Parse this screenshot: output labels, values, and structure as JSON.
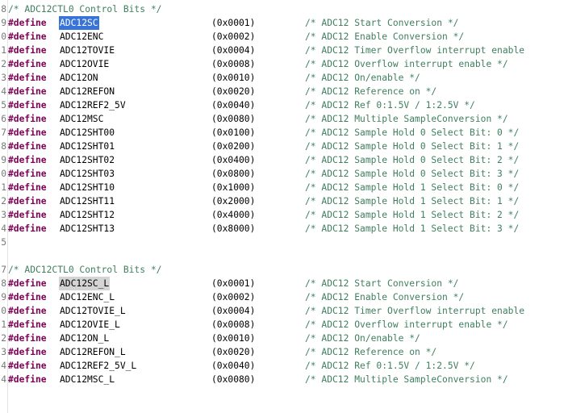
{
  "editor": {
    "keyword": "#define",
    "block1": {
      "line_number": "8",
      "header": "/* ADC12CTL0 Control Bits */",
      "rows": [
        {
          "ln": "9",
          "name": "ADC12SC",
          "value": "(0x0001)",
          "comment": "/* ADC12 Start Conversion */",
          "state": "selected"
        },
        {
          "ln": "0",
          "name": "ADC12ENC",
          "value": "(0x0002)",
          "comment": "/* ADC12 Enable Conversion */",
          "state": ""
        },
        {
          "ln": "1",
          "name": "ADC12TOVIE",
          "value": "(0x0004)",
          "comment": "/* ADC12 Timer Overflow interrupt enable",
          "state": ""
        },
        {
          "ln": "2",
          "name": "ADC12OVIE",
          "value": "(0x0008)",
          "comment": "/* ADC12 Overflow interrupt enable */",
          "state": ""
        },
        {
          "ln": "3",
          "name": "ADC12ON",
          "value": "(0x0010)",
          "comment": "/* ADC12 On/enable */",
          "state": ""
        },
        {
          "ln": "4",
          "name": "ADC12REFON",
          "value": "(0x0020)",
          "comment": "/* ADC12 Reference on */",
          "state": ""
        },
        {
          "ln": "5",
          "name": "ADC12REF2_5V",
          "value": "(0x0040)",
          "comment": "/* ADC12 Ref 0:1.5V / 1:2.5V */",
          "state": ""
        },
        {
          "ln": "6",
          "name": "ADC12MSC",
          "value": "(0x0080)",
          "comment": "/* ADC12 Multiple SampleConversion */",
          "state": ""
        },
        {
          "ln": "7",
          "name": "ADC12SHT00",
          "value": "(0x0100)",
          "comment": "/* ADC12 Sample Hold 0 Select Bit: 0 */",
          "state": ""
        },
        {
          "ln": "8",
          "name": "ADC12SHT01",
          "value": "(0x0200)",
          "comment": "/* ADC12 Sample Hold 0 Select Bit: 1 */",
          "state": ""
        },
        {
          "ln": "9",
          "name": "ADC12SHT02",
          "value": "(0x0400)",
          "comment": "/* ADC12 Sample Hold 0 Select Bit: 2 */",
          "state": ""
        },
        {
          "ln": "0",
          "name": "ADC12SHT03",
          "value": "(0x0800)",
          "comment": "/* ADC12 Sample Hold 0 Select Bit: 3 */",
          "state": ""
        },
        {
          "ln": "1",
          "name": "ADC12SHT10",
          "value": "(0x1000)",
          "comment": "/* ADC12 Sample Hold 1 Select Bit: 0 */",
          "state": ""
        },
        {
          "ln": "2",
          "name": "ADC12SHT11",
          "value": "(0x2000)",
          "comment": "/* ADC12 Sample Hold 1 Select Bit: 1 */",
          "state": ""
        },
        {
          "ln": "3",
          "name": "ADC12SHT12",
          "value": "(0x4000)",
          "comment": "/* ADC12 Sample Hold 1 Select Bit: 2 */",
          "state": ""
        },
        {
          "ln": "4",
          "name": "ADC12SHT13",
          "value": "(0x8000)",
          "comment": "/* ADC12 Sample Hold 1 Select Bit: 3 */",
          "state": ""
        }
      ]
    },
    "blank_line_number": "5",
    "block2": {
      "line_number": "7",
      "header": "/* ADC12CTL0 Control Bits */",
      "rows": [
        {
          "ln": "8",
          "name": "ADC12SC_L",
          "value": "(0x0001)",
          "comment": "/* ADC12 Start Conversion */",
          "state": "highlight"
        },
        {
          "ln": "9",
          "name": "ADC12ENC_L",
          "value": "(0x0002)",
          "comment": "/* ADC12 Enable Conversion */",
          "state": ""
        },
        {
          "ln": "0",
          "name": "ADC12TOVIE_L",
          "value": "(0x0004)",
          "comment": "/* ADC12 Timer Overflow interrupt enable",
          "state": ""
        },
        {
          "ln": "1",
          "name": "ADC12OVIE_L",
          "value": "(0x0008)",
          "comment": "/* ADC12 Overflow interrupt enable */",
          "state": ""
        },
        {
          "ln": "2",
          "name": "ADC12ON_L",
          "value": "(0x0010)",
          "comment": "/* ADC12 On/enable */",
          "state": ""
        },
        {
          "ln": "3",
          "name": "ADC12REFON_L",
          "value": "(0x0020)",
          "comment": "/* ADC12 Reference on */",
          "state": ""
        },
        {
          "ln": "4",
          "name": "ADC12REF2_5V_L",
          "value": "(0x0040)",
          "comment": "/* ADC12 Ref 0:1.5V / 1:2.5V */",
          "state": ""
        },
        {
          "ln": "4",
          "name": "ADC12MSC_L",
          "value": "(0x0080)",
          "comment": "/* ADC12 Multiple SampleConversion */",
          "state": ""
        }
      ]
    }
  }
}
